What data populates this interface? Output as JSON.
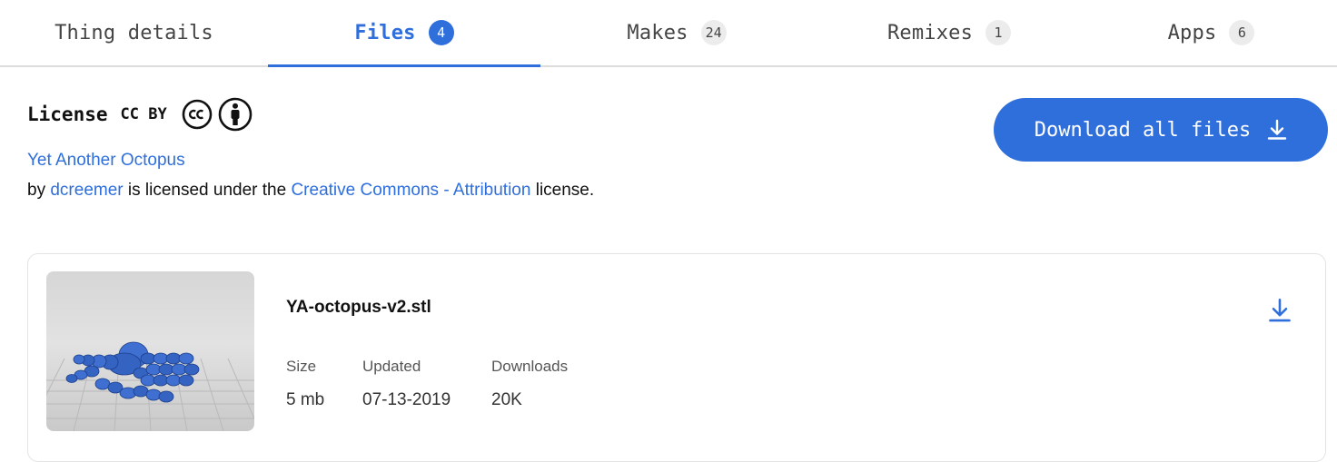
{
  "tabs": [
    {
      "label": "Thing details",
      "count": null,
      "active": false
    },
    {
      "label": "Files",
      "count": "4",
      "active": true
    },
    {
      "label": "Makes",
      "count": "24",
      "active": false
    },
    {
      "label": "Remixes",
      "count": "1",
      "active": false
    },
    {
      "label": "Apps",
      "count": "6",
      "active": false
    }
  ],
  "license": {
    "title": "License",
    "code": "CC BY",
    "icons": [
      "creative-commons-icon",
      "attribution-icon"
    ],
    "model_name": "Yet Another Octopus",
    "credit_by": "by",
    "author": "dcreemer",
    "credit_mid": "is licensed under the",
    "license_name": "Creative Commons - Attribution",
    "credit_end": "license."
  },
  "download_all": {
    "label": "Download all files",
    "icon": "download-icon"
  },
  "file": {
    "name": "YA-octopus-v2.stl",
    "thumbnail_icon": "octopus-model-thumbnail",
    "columns": [
      {
        "label": "Size",
        "value": "5 mb"
      },
      {
        "label": "Updated",
        "value": "07-13-2019"
      },
      {
        "label": "Downloads",
        "value": "20K"
      }
    ],
    "download_icon": "download-icon"
  },
  "colors": {
    "accent": "#2f6fdc",
    "text": "#111111",
    "muted": "#555555",
    "badge_bg": "#ececec",
    "tab_border": "#dcdcdc"
  }
}
